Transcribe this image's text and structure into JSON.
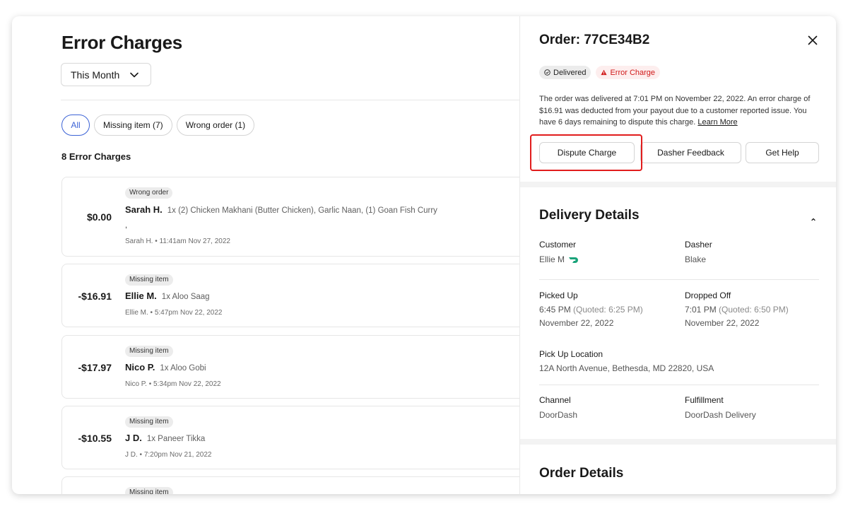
{
  "left": {
    "title": "Error Charges",
    "month_select": "This Month",
    "filters": [
      "All",
      "Missing item (7)",
      "Wrong order (1)"
    ],
    "count_title": "8 Error Charges",
    "charges": [
      {
        "amount": "$0.00",
        "badge": "Wrong order",
        "name": "Sarah H.",
        "items": "1x (2) Chicken Makhani (Butter Chicken), Garlic Naan, (1) Goan Fish Curry",
        "comma": ",",
        "meta": "Sarah H. • 11:41am Nov 27, 2022"
      },
      {
        "amount": "-$16.91",
        "badge": "Missing item",
        "name": "Ellie M.",
        "items": "1x Aloo Saag",
        "meta": "Ellie M. • 5:47pm Nov 22, 2022"
      },
      {
        "amount": "-$17.97",
        "badge": "Missing item",
        "name": "Nico P.",
        "items": "1x Aloo Gobi",
        "meta": "Nico P. • 5:34pm Nov 22, 2022"
      },
      {
        "amount": "-$10.55",
        "badge": "Missing item",
        "name": "J D.",
        "items": "1x Paneer Tikka",
        "meta": "J D. • 7:20pm Nov 21, 2022"
      },
      {
        "badge": "Missing item"
      }
    ]
  },
  "detail": {
    "order_title": "Order: 77CE34B2",
    "status_delivered": "Delivered",
    "status_error": "Error Charge",
    "description": "The order was delivered at 7:01 PM on November 22, 2022. An error charge of $16.91 was deducted from your payout due to a customer reported issue. You have 6 days remaining to dispute this charge.",
    "learn_more": "Learn More",
    "buttons": {
      "dispute": "Dispute Charge",
      "feedback": "Dasher Feedback",
      "help": "Get Help"
    },
    "delivery_title": "Delivery Details",
    "customer_label": "Customer",
    "customer_value": "Ellie M",
    "dasher_label": "Dasher",
    "dasher_value": "Blake",
    "picked_label": "Picked Up",
    "picked_time": "6:45 PM",
    "picked_quoted": "(Quoted: 6:25 PM)",
    "picked_date": "November 22, 2022",
    "dropped_label": "Dropped Off",
    "dropped_time": "7:01 PM",
    "dropped_quoted": "(Quoted: 6:50 PM)",
    "dropped_date": "November 22, 2022",
    "location_label": "Pick Up Location",
    "location_value": "12A North Avenue, Bethesda, MD 22820, USA",
    "channel_label": "Channel",
    "channel_value": "DoorDash",
    "fulfillment_label": "Fulfillment",
    "fulfillment_value": "DoorDash Delivery",
    "order_details_title": "Order Details"
  },
  "colors": {
    "accent": "#3c63d6",
    "error": "#d11a1a",
    "highlight": "#e11d1d"
  },
  "icons": [
    "chevron-down-icon",
    "close-icon",
    "check-circle-icon",
    "warning-icon",
    "chevron-up-icon",
    "doordash-logo-icon"
  ]
}
